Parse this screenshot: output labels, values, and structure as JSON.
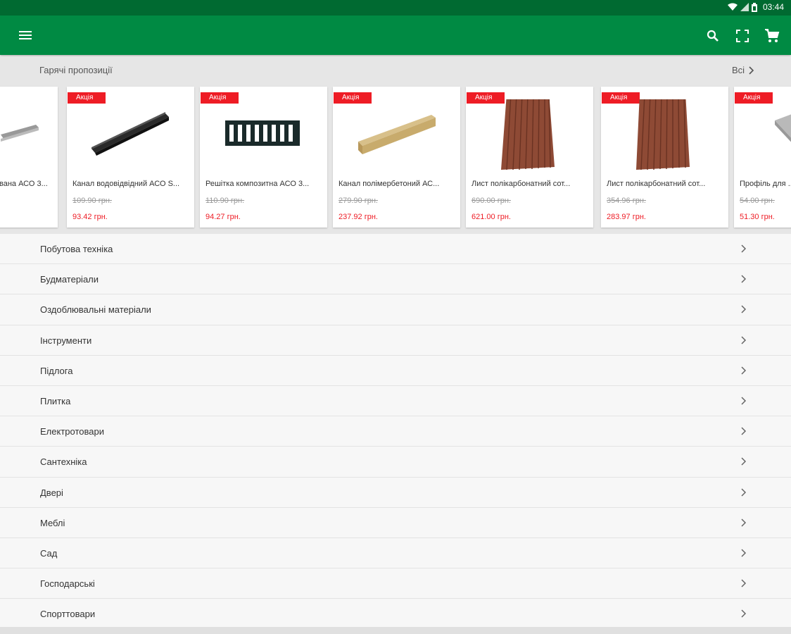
{
  "status_bar": {
    "time": "03:44",
    "icons": [
      "wifi-icon",
      "signal-icon",
      "battery-icon"
    ]
  },
  "app_bar": {
    "icons": [
      "menu-icon",
      "search-icon",
      "fullscreen-icon",
      "cart-icon"
    ],
    "color": "#008a43"
  },
  "hot_offers": {
    "title": "Гарячі пропозиції",
    "all_label": "Всі",
    "badge_color": "#ee1c25",
    "items": [
      {
        "badge": "",
        "name": "вана АСО 3...",
        "old_price": "",
        "new_price": "",
        "image": "grate-icon"
      },
      {
        "badge": "Акція",
        "name": "Канал водовідвідний АСО S...",
        "old_price": "109.90 грн.",
        "new_price": "93.42 грн.",
        "image": "channel-black-icon"
      },
      {
        "badge": "Акція",
        "name": "Решітка композитна АСО 3...",
        "old_price": "110.90 грн.",
        "new_price": "94.27 грн.",
        "image": "grate-black-icon"
      },
      {
        "badge": "Акція",
        "name": "Канал полімербетоний АС...",
        "old_price": "279.90 грн.",
        "new_price": "237.92 грн.",
        "image": "channel-beige-icon"
      },
      {
        "badge": "Акція",
        "name": "Лист полікарбонатний сот...",
        "old_price": "690.00 грн.",
        "new_price": "621.00 грн.",
        "image": "polycarbonate-sheet-icon"
      },
      {
        "badge": "Акція",
        "name": "Лист полікарбонатний сот...",
        "old_price": "354.96 грн.",
        "new_price": "283.97 грн.",
        "image": "polycarbonate-sheet-icon"
      },
      {
        "badge": "Акція",
        "name": "Профіль для ...",
        "old_price": "54.00 грн.",
        "new_price": "51.30 грн.",
        "image": "profile-icon"
      }
    ]
  },
  "categories": [
    "Побутова техніка",
    "Будматеріали",
    "Оздоблювальні матеріали",
    "Інструменти",
    "Підлога",
    "Плитка",
    "Електротовари",
    "Сантехніка",
    "Двері",
    "Меблі",
    "Сад",
    "Господарськi",
    "Спорттовари"
  ]
}
